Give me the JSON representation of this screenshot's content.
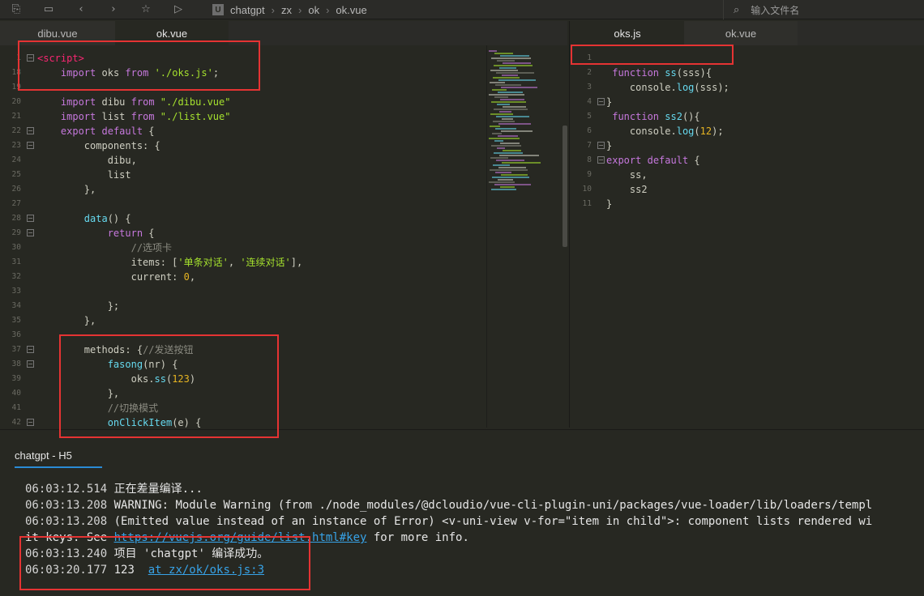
{
  "breadcrumb": [
    "chatgpt",
    "zx",
    "ok",
    "ok.vue"
  ],
  "file_search": {
    "placeholder": "输入文件名"
  },
  "left_tabs": [
    "dibu.vue",
    "ok.vue"
  ],
  "right_tabs": [
    "oks.js",
    "ok.vue"
  ],
  "left_code": [
    {
      "n": "1",
      "fold": true,
      "html": "<span class='tag'>&lt;script&gt;</span>"
    },
    {
      "n": "18",
      "html": "    <span class='kw'>import</span> <span class='tx'>oks</span> <span class='kw'>from</span> <span class='str'>'./oks.js'</span>;"
    },
    {
      "n": "19",
      "html": ""
    },
    {
      "n": "20",
      "html": "    <span class='kw'>import</span> <span class='tx'>dibu</span> <span class='kw'>from</span> <span class='str'>\"./dibu.vue\"</span>"
    },
    {
      "n": "21",
      "html": "    <span class='kw'>import</span> <span class='tx'>list</span> <span class='kw'>from</span> <span class='str'>\"./list.vue\"</span>"
    },
    {
      "n": "22",
      "fold": true,
      "html": "    <span class='kw'>export</span> <span class='kw'>default</span> {"
    },
    {
      "n": "23",
      "fold": true,
      "html": "        <span class='tx'>components</span>: {"
    },
    {
      "n": "24",
      "html": "            <span class='tx'>dibu</span>,"
    },
    {
      "n": "25",
      "html": "            <span class='tx'>list</span>"
    },
    {
      "n": "26",
      "html": "        },"
    },
    {
      "n": "27",
      "html": ""
    },
    {
      "n": "28",
      "fold": true,
      "html": "        <span class='fn'>data</span>() {"
    },
    {
      "n": "29",
      "fold": true,
      "html": "            <span class='kw'>return</span> {"
    },
    {
      "n": "30",
      "html": "                <span class='cm'>//选项卡</span>"
    },
    {
      "n": "31",
      "html": "                <span class='tx'>items</span>: [<span class='str'>'单条对话'</span>, <span class='str'>'连续对话'</span>],"
    },
    {
      "n": "32",
      "html": "                <span class='tx'>current</span>: <span class='num'>0</span>,"
    },
    {
      "n": "33",
      "html": ""
    },
    {
      "n": "34",
      "html": "            };"
    },
    {
      "n": "35",
      "html": "        },"
    },
    {
      "n": "36",
      "html": ""
    },
    {
      "n": "37",
      "fold": true,
      "html": "        <span class='tx'>methods</span>: {<span class='cm'>//发送按钮</span>"
    },
    {
      "n": "38",
      "fold": true,
      "html": "            <span class='fn'>fasong</span>(<span class='tx'>nr</span>) {"
    },
    {
      "n": "39",
      "html": "                <span class='tx'>oks</span>.<span class='fn'>ss</span>(<span class='num'>123</span>)"
    },
    {
      "n": "40",
      "html": "            },"
    },
    {
      "n": "41",
      "html": "            <span class='cm'>//切换模式</span>"
    },
    {
      "n": "42",
      "fold": true,
      "html": "            <span class='fn'>onClickItem</span>(<span class='tx'>e</span>) {"
    }
  ],
  "right_code": [
    {
      "n": "1",
      "html": ""
    },
    {
      "n": "2",
      "html": " <span class='kw'>function</span> <span class='fn'>ss</span>(<span class='tx'>sss</span>){"
    },
    {
      "n": "3",
      "html": "    <span class='tx'>console</span>.<span class='fn'>log</span>(<span class='tx'>sss</span>);"
    },
    {
      "n": "4",
      "fold": true,
      "html": "}"
    },
    {
      "n": "5",
      "html": " <span class='kw'>function</span> <span class='fn'>ss2</span>(){"
    },
    {
      "n": "6",
      "html": "    <span class='tx'>console</span>.<span class='fn'>log</span>(<span class='num'>12</span>);"
    },
    {
      "n": "7",
      "fold": true,
      "html": "}"
    },
    {
      "n": "8",
      "fold": true,
      "html": "<span class='kw'>export</span> <span class='kw'>default</span> {"
    },
    {
      "n": "9",
      "html": "    <span class='tx'>ss</span>,"
    },
    {
      "n": "10",
      "html": "    <span class='tx'>ss2</span>"
    },
    {
      "n": "11",
      "html": "}"
    }
  ],
  "console": {
    "tab_label": "chatgpt - H5",
    "lines": [
      {
        "ts": "06:03:12.514",
        "text": " 正在差量编译..."
      },
      {
        "ts": "06:03:13.208",
        "text": " WARNING: Module Warning (from ./node_modules/@dcloudio/vue-cli-plugin-uni/packages/vue-loader/lib/loaders/templ"
      },
      {
        "ts": "06:03:13.208",
        "text": " (Emitted value instead of an instance of Error) <v-uni-view v-for=\"item in child\">: component lists rendered wi"
      },
      {
        "ts": "",
        "text": "it keys. See ",
        "link": "https://vuejs.org/guide/list.html#key",
        "after": " for more info."
      },
      {
        "ts": "06:03:13.240",
        "text": " 项目 'chatgpt' 编译成功。"
      },
      {
        "ts": "06:03:20.177",
        "text": " 123  ",
        "link": "at zx/ok/oks.js:3"
      }
    ]
  },
  "colors": {
    "highlight_box": "#e53333",
    "link": "#37a3e8",
    "tab_underline": "#2a8bd6"
  }
}
